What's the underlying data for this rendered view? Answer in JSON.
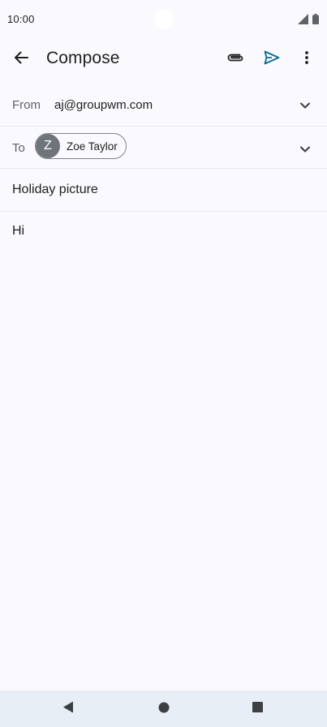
{
  "status_bar": {
    "time": "10:00",
    "icons": [
      "signal-icon",
      "battery-icon"
    ]
  },
  "app_bar": {
    "back_icon": "arrow-back-icon",
    "title": "Compose",
    "actions": [
      "paperclip-icon",
      "send-icon",
      "more-vert-icon"
    ]
  },
  "compose": {
    "from_label": "From",
    "from_value": "aj@groupwm.com",
    "to_label": "To",
    "recipient": {
      "initial": "Z",
      "name": "Zoe Taylor"
    },
    "subject": "Holiday picture",
    "body": "Hi"
  },
  "nav_bar": {
    "buttons": [
      "back-triangle-icon",
      "home-circle-icon",
      "recents-square-icon"
    ]
  },
  "colors": {
    "background": "#f9f9fe",
    "send_accent": "#0b6b8f",
    "chip_avatar": "#6f747a",
    "nav_bar": "#e8eef6"
  }
}
